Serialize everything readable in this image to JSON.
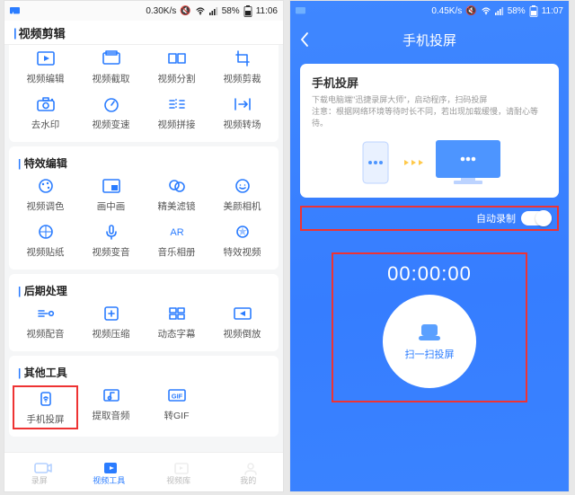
{
  "colors": {
    "primary": "#2a7cff",
    "danger_border": "#e33"
  },
  "left": {
    "statusbar": {
      "speed": "0.30K/s",
      "battery": "58%",
      "time": "11:06"
    },
    "header_title": "视频剪辑",
    "sections": [
      {
        "heading": "",
        "items": [
          {
            "icon": "edit-clip-icon",
            "label": "视频编辑"
          },
          {
            "icon": "capture-icon",
            "label": "视频截取"
          },
          {
            "icon": "split-icon",
            "label": "视频分割"
          },
          {
            "icon": "crop-icon",
            "label": "视频剪裁"
          },
          {
            "icon": "camera-icon",
            "label": "去水印"
          },
          {
            "icon": "speed-icon",
            "label": "视频变速"
          },
          {
            "icon": "merge-icon",
            "label": "视频拼接"
          },
          {
            "icon": "transition-icon",
            "label": "视频转场"
          }
        ]
      },
      {
        "heading": "特效编辑",
        "items": [
          {
            "icon": "palette-icon",
            "label": "视频调色"
          },
          {
            "icon": "pip-icon",
            "label": "画中画"
          },
          {
            "icon": "filter-icon",
            "label": "精美滤镜"
          },
          {
            "icon": "beauty-icon",
            "label": "美颜相机"
          },
          {
            "icon": "sticker-icon",
            "label": "视频贴纸"
          },
          {
            "icon": "voice-icon",
            "label": "视频变音"
          },
          {
            "icon": "ar-icon",
            "label": "音乐相册"
          },
          {
            "icon": "effect-icon",
            "label": "特效视频"
          }
        ]
      },
      {
        "heading": "后期处理",
        "items": [
          {
            "icon": "dub-icon",
            "label": "视频配音"
          },
          {
            "icon": "compress-icon",
            "label": "视频压缩"
          },
          {
            "icon": "subtitle-icon",
            "label": "动态字幕"
          },
          {
            "icon": "reverse-icon",
            "label": "视频倒放"
          }
        ]
      },
      {
        "heading": "其他工具",
        "items": [
          {
            "icon": "cast-icon",
            "label": "手机投屏",
            "highlighted": true
          },
          {
            "icon": "extract-audio-icon",
            "label": "提取音频"
          },
          {
            "icon": "gif-icon",
            "label": "转GIF"
          }
        ]
      }
    ],
    "bottom_nav": [
      {
        "icon": "record-nav-icon",
        "label": "录屏",
        "active": false
      },
      {
        "icon": "tools-nav-icon",
        "label": "视频工具",
        "active": true
      },
      {
        "icon": "library-nav-icon",
        "label": "视频库",
        "active": false
      },
      {
        "icon": "me-nav-icon",
        "label": "我的",
        "active": false
      }
    ]
  },
  "right": {
    "statusbar": {
      "speed": "0.45K/s",
      "battery": "58%",
      "time": "11:07"
    },
    "header_title": "手机投屏",
    "card": {
      "title": "手机投屏",
      "line1": "下载电脑端\"迅捷录屏大师\"，启动程序，扫码投屏",
      "line2": "注意：根据网络环境等待时长不同，若出现加载缓慢，请耐心等待。"
    },
    "auto_record_label": "自动录制",
    "auto_record_on": true,
    "timer": "00:00:00",
    "scan_button_label": "扫一扫投屏"
  }
}
